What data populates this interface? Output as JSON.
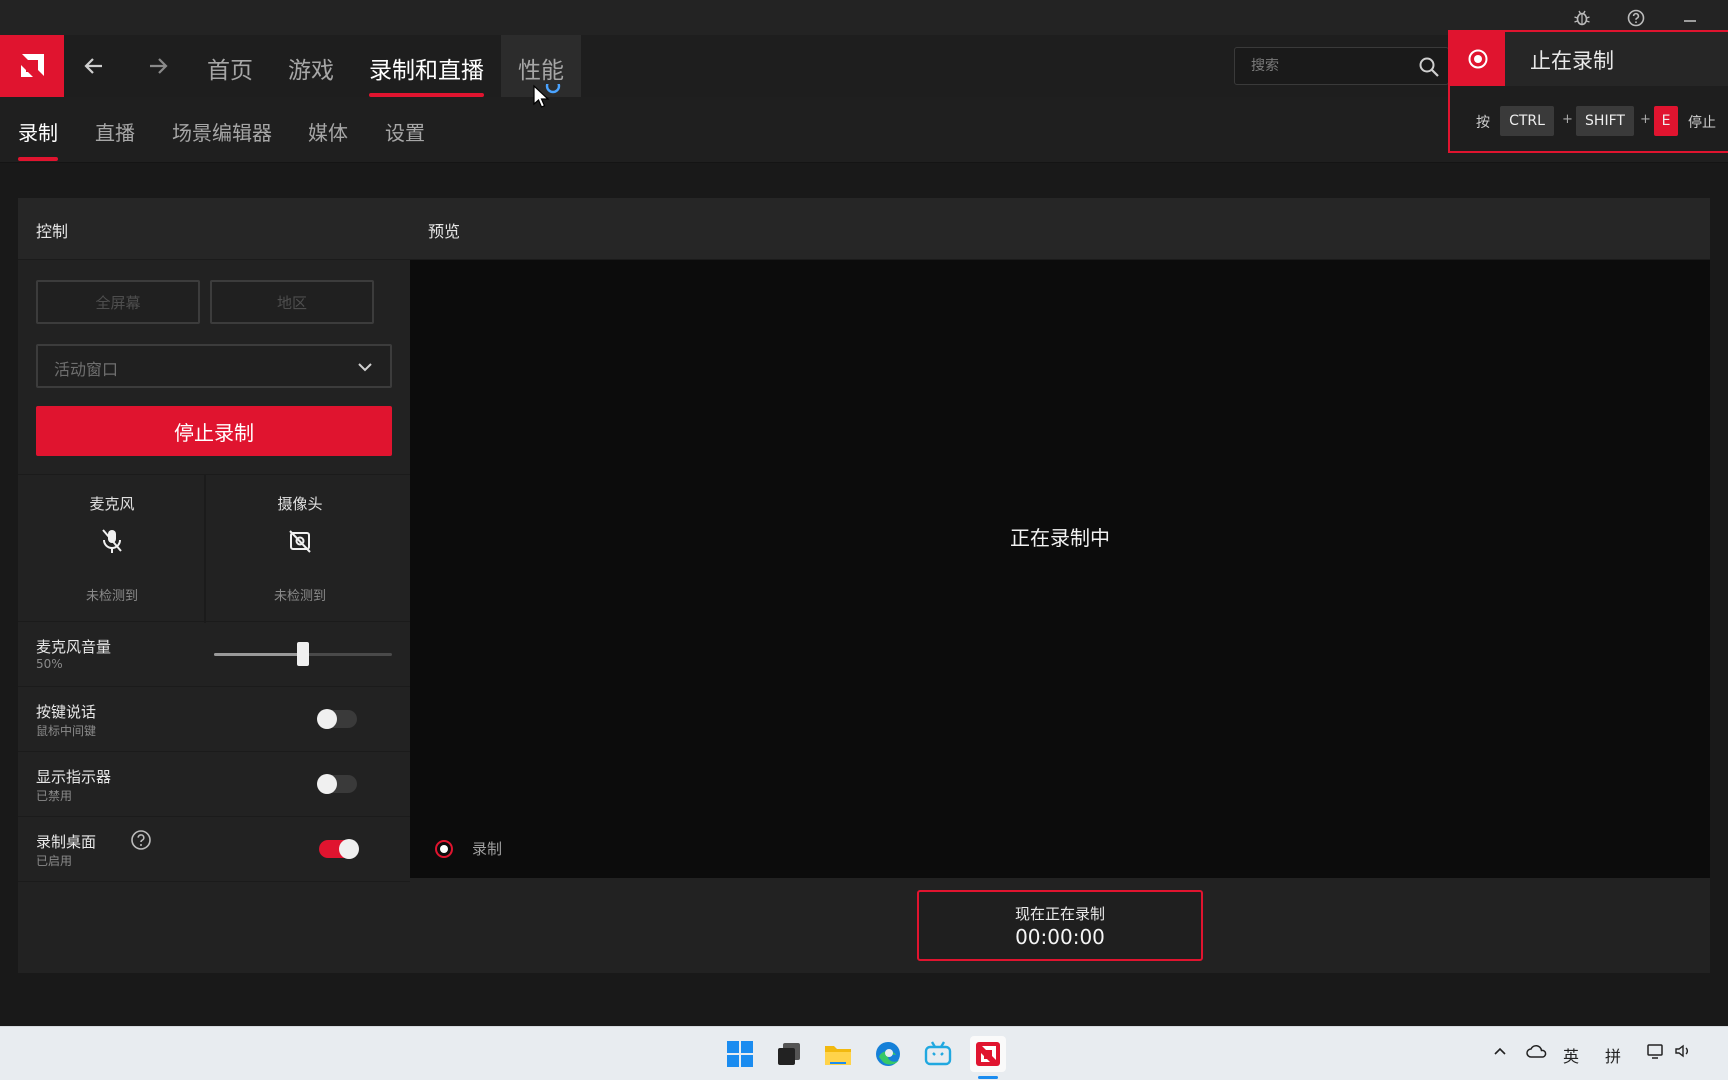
{
  "nav": {
    "tabs": [
      "首页",
      "游戏",
      "录制和直播",
      "性能"
    ],
    "active_tab": "录制和直播",
    "search_placeholder": "搜索"
  },
  "subnav": {
    "tabs": [
      "录制",
      "直播",
      "场景编辑器",
      "媒体",
      "设置"
    ],
    "active_tab": "录制"
  },
  "control": {
    "title": "控制",
    "fullscreen_label": "全屏幕",
    "region_label": "地区",
    "window_select": "活动窗口",
    "stop_button": "停止录制",
    "microphone": {
      "title": "麦克风",
      "status": "未检测到",
      "icon": "mic-off-icon"
    },
    "camera": {
      "title": "摄像头",
      "status": "未检测到",
      "icon": "camera-off-icon"
    },
    "mic_volume": {
      "title": "麦克风音量",
      "value": "50%",
      "level": 0.5
    },
    "push_to_talk": {
      "title": "按键说话",
      "sub": "鼠标中间键",
      "on": false
    },
    "show_indicator": {
      "title": "显示指示器",
      "sub": "已禁用",
      "on": false
    },
    "record_desktop": {
      "title": "录制桌面",
      "sub": "已启用",
      "on": true
    }
  },
  "preview": {
    "title": "预览",
    "message": "正在录制中",
    "indicator_label": "录制",
    "status_label": "现在正在录制",
    "timer": "00:00:00"
  },
  "notification": {
    "title": "止在录制",
    "press": "按",
    "keys": [
      "CTRL",
      "SHIFT",
      "E"
    ],
    "suffix": "停止",
    "plus": "+"
  },
  "tray": {
    "lang": "英",
    "ime": "拼"
  },
  "colors": {
    "accent": "#e0142f",
    "background": "#191919",
    "panel": "#222222"
  }
}
